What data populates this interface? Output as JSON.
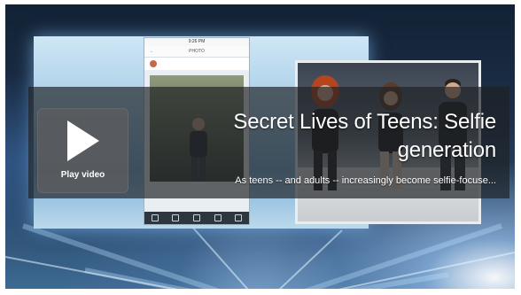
{
  "video": {
    "title": "Secret Lives of Teens: Selfie generation",
    "description": "As teens -- and adults -- increasingly become selfie-focuse...",
    "play_label": "Play video",
    "play_icon": "play-icon"
  },
  "thumbnail": {
    "phone_status": "9:26 PM",
    "phone_header": "PHOTO",
    "phone_back": "←"
  },
  "colors": {
    "overlay": "#1e2024",
    "play_box": "#5a5c60",
    "text": "#ffffff"
  }
}
